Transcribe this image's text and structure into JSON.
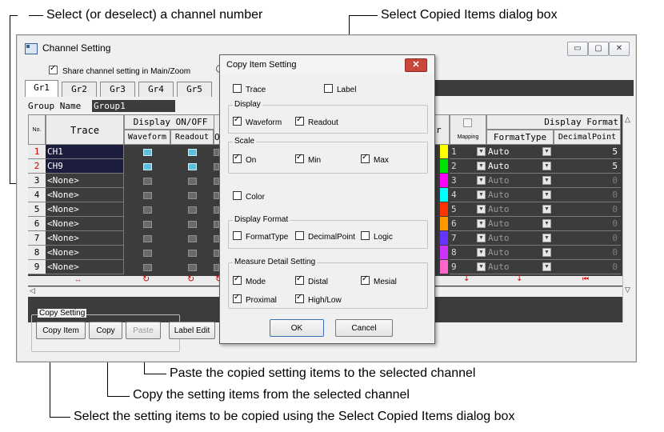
{
  "callouts": {
    "select_channel": "Select (or deselect) a channel number",
    "select_dialog": "Select Copied Items dialog box",
    "paste": "Paste the copied setting items to the selected channel",
    "copy": "Copy the setting items from the selected channel",
    "copy_item": "Select the setting items to be copied using the Select Copied Items dialog box"
  },
  "window": {
    "title": "Channel Setting",
    "share_label": "Share channel setting in Main/Zoom",
    "share_checked": true,
    "controls": {
      "minimize": "▭",
      "maximize": "▢",
      "close": "✕"
    }
  },
  "tabs": [
    "Gr1",
    "Gr2",
    "Gr3",
    "Gr4",
    "Gr5"
  ],
  "group_name": {
    "label": "Group Name",
    "value": "Group1"
  },
  "grid": {
    "headers": {
      "no": "No.",
      "trace": "Trace",
      "display_onoff": "Display ON/OFF",
      "waveform": "Waveform",
      "readout": "Readout",
      "partial": "O",
      "color_partial": "r",
      "mapping": "Mapping",
      "display_format": "Display Format",
      "format_type": "FormatType",
      "decimal_point": "DecimalPoint"
    },
    "rows": [
      {
        "no": "1",
        "trace": "CH1",
        "active": true,
        "mapping": "1",
        "format": "Auto",
        "decimal": "5",
        "color": "#ffff00"
      },
      {
        "no": "2",
        "trace": "CH9",
        "active": true,
        "mapping": "2",
        "format": "Auto",
        "decimal": "5",
        "color": "#00e000"
      },
      {
        "no": "3",
        "trace": "<None>",
        "active": false,
        "mapping": "3",
        "format": "Auto",
        "decimal": "0",
        "color": "#ff00ff"
      },
      {
        "no": "4",
        "trace": "<None>",
        "active": false,
        "mapping": "4",
        "format": "Auto",
        "decimal": "0",
        "color": "#00ffff"
      },
      {
        "no": "5",
        "trace": "<None>",
        "active": false,
        "mapping": "5",
        "format": "Auto",
        "decimal": "0",
        "color": "#ff3300"
      },
      {
        "no": "6",
        "trace": "<None>",
        "active": false,
        "mapping": "6",
        "format": "Auto",
        "decimal": "0",
        "color": "#ff9900"
      },
      {
        "no": "7",
        "trace": "<None>",
        "active": false,
        "mapping": "7",
        "format": "Auto",
        "decimal": "0",
        "color": "#6633ff"
      },
      {
        "no": "8",
        "trace": "<None>",
        "active": false,
        "mapping": "8",
        "format": "Auto",
        "decimal": "0",
        "color": "#cc33ff"
      },
      {
        "no": "9",
        "trace": "<None>",
        "active": false,
        "mapping": "9",
        "format": "Auto",
        "decimal": "0",
        "color": "#ff66cc"
      }
    ]
  },
  "copy_setting": {
    "label": "Copy Setting",
    "copy_item": "Copy Item",
    "copy": "Copy",
    "paste": "Paste",
    "label_edit": "Label Edit"
  },
  "dialog": {
    "title": "Copy Item Setting",
    "close": "✕",
    "trace": {
      "label": "Trace",
      "checked": false
    },
    "label": {
      "label": "Label",
      "checked": false
    },
    "display": {
      "legend": "Display",
      "waveform": "Waveform",
      "readout": "Readout"
    },
    "scale": {
      "legend": "Scale",
      "on": "On",
      "min": "Min",
      "max": "Max"
    },
    "color": {
      "label": "Color",
      "checked": false
    },
    "display_format": {
      "legend": "Display Format",
      "format_type": "FormatType",
      "decimal_point": "DecimalPoint",
      "logic": "Logic"
    },
    "measure": {
      "legend": "Measure Detail Setting",
      "mode": "Mode",
      "distal": "Distal",
      "mesial": "Mesial",
      "proximal": "Proximal",
      "highlow": "High/Low"
    },
    "ok": "OK",
    "cancel": "Cancel"
  }
}
